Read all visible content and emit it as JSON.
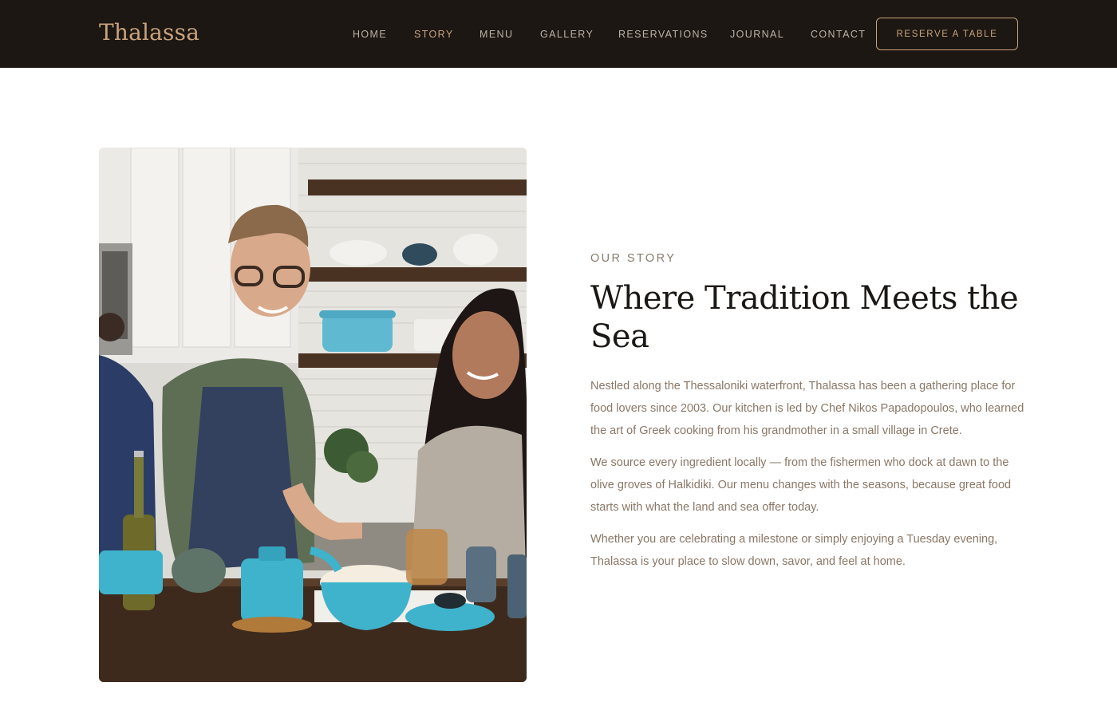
{
  "brand": {
    "name": "Thalassa"
  },
  "nav": {
    "items": [
      {
        "label": "HOME"
      },
      {
        "label": "STORY"
      },
      {
        "label": "MENU"
      },
      {
        "label": "GALLERY"
      },
      {
        "label": "RESERVATIONS"
      },
      {
        "label": "JOURNAL"
      },
      {
        "label": "CONTACT"
      }
    ],
    "active": "STORY",
    "cta_label": "RESERVE A TABLE"
  },
  "story": {
    "eyebrow": "OUR STORY",
    "heading": "Where Tradition Meets the Sea",
    "paragraphs": [
      "Nestled along the Thessaloniki waterfront, Thalassa has been a gathering place for food lovers since 2003. Our kitchen is led by Chef Nikos Papadopoulos, who learned the art of Greek cooking from his grandmother in a small village in Crete.",
      "We source every ingredient locally — from the fishermen who dock at dawn to the olive groves of Halkidiki. Our menu changes with the seasons, because great food starts with what the land and sea offer today.",
      "Whether you are celebrating a milestone or simply enjoying a Tuesday evening, Thalassa is your place to slow down, savor, and feel at home."
    ]
  },
  "colors": {
    "header_bg": "#1c1713",
    "accent": "#c9a37c",
    "nav_text": "#bdb2a6",
    "heading": "#1a1714",
    "body_text": "#8a7766"
  }
}
